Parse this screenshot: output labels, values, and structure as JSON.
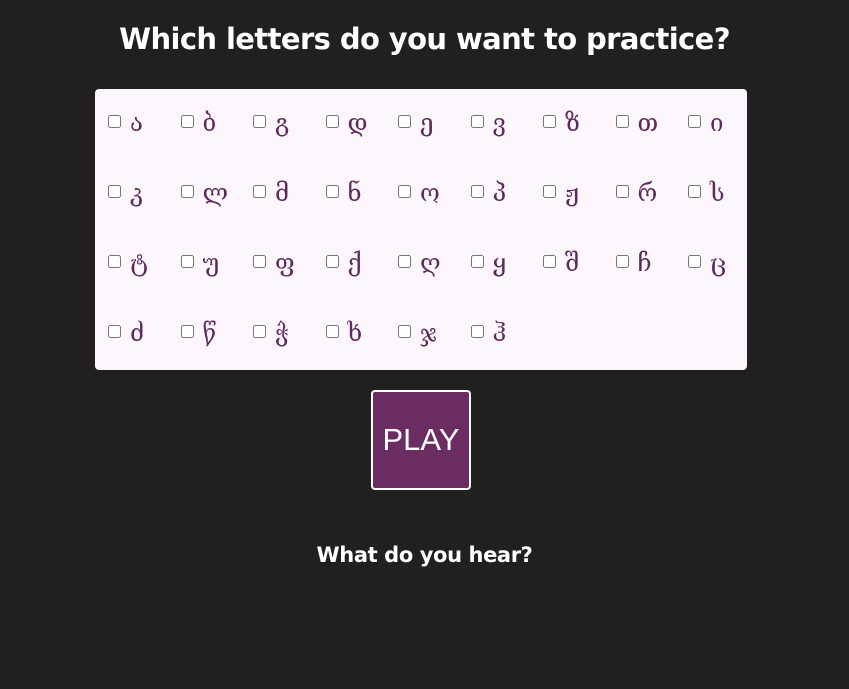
{
  "header": {
    "title": "Which letters do you want to practice?"
  },
  "letters": [
    "ა",
    "ბ",
    "გ",
    "დ",
    "ე",
    "ვ",
    "ზ",
    "თ",
    "ი",
    "კ",
    "ლ",
    "მ",
    "ნ",
    "ო",
    "პ",
    "ჟ",
    "რ",
    "ს",
    "ტ",
    "უ",
    "ფ",
    "ქ",
    "ღ",
    "ყ",
    "შ",
    "ჩ",
    "ც",
    "ძ",
    "წ",
    "ჭ",
    "ხ",
    "ჯ",
    "ჰ"
  ],
  "play_button": {
    "label": "PLAY"
  },
  "prompt": {
    "text": "What do you hear?"
  },
  "colors": {
    "background": "#221f1f",
    "panel": "#fdf7fd",
    "letter": "#5c2a5b",
    "button": "#6b2d61"
  }
}
